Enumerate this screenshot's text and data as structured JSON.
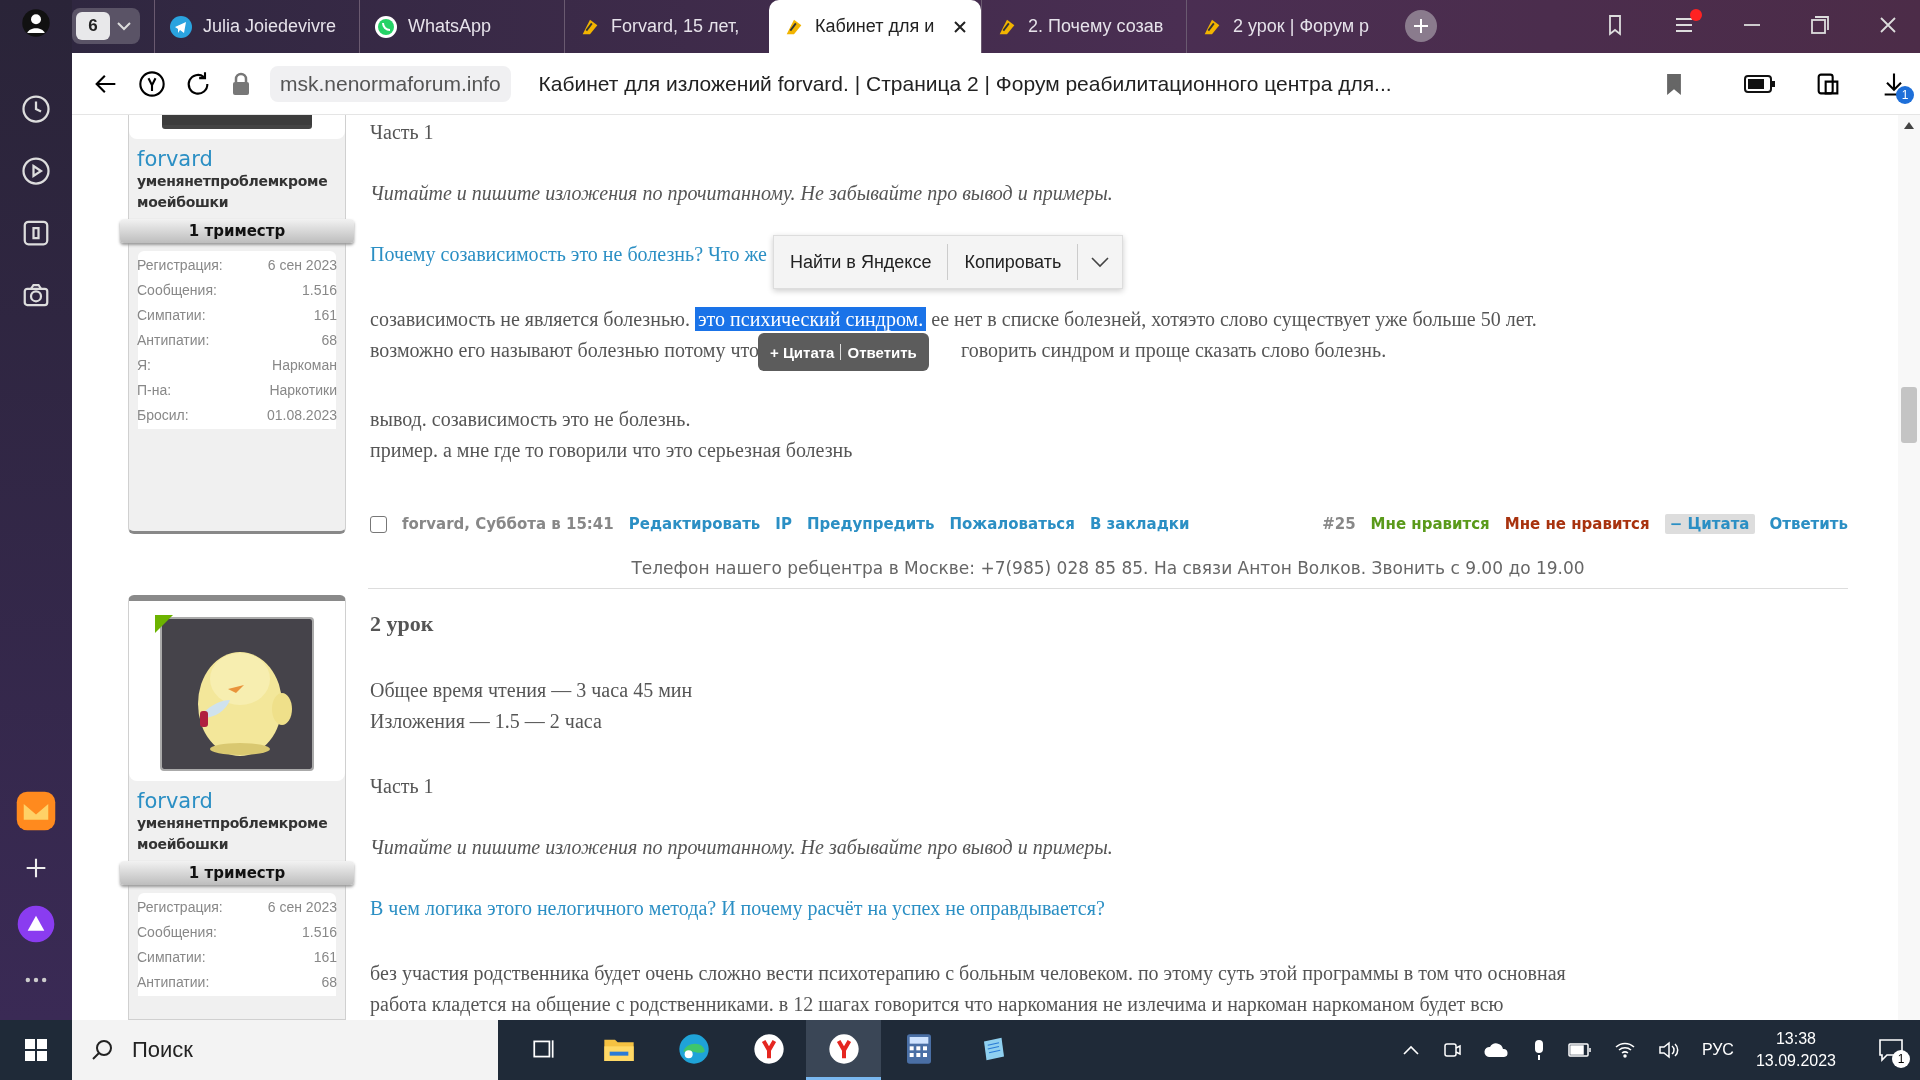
{
  "browser": {
    "tab_count": "6",
    "tabs": [
      {
        "title": "Julia Joiedevivre",
        "selected": false
      },
      {
        "title": "WhatsApp",
        "selected": false
      },
      {
        "title": "Forvard, 15 лет, ",
        "selected": false
      },
      {
        "title": "Кабинет для и",
        "selected": true
      },
      {
        "title": "2. Почему созав",
        "selected": false
      },
      {
        "title": "2 урок | Форум р",
        "selected": false
      }
    ],
    "url": "msk.nenormaforum.info",
    "page_title": "Кабинет для изложений forvard. | Страница 2 | Форум реабилитационного центра для...",
    "downloads_badge": "1"
  },
  "posts": [
    {
      "user": {
        "name": "forvard",
        "user_title": "уменянетпроблемкроме моейбошки",
        "rank": "1 триместр",
        "stats": [
          {
            "label": "Регистрация:",
            "value": "6 сен 2023"
          },
          {
            "label": "Сообщения:",
            "value": "1.516"
          },
          {
            "label": "Симпатии:",
            "value": "161"
          },
          {
            "label": "Антипатии:",
            "value": "68"
          },
          {
            "label": "Я:",
            "value": "Наркоман"
          },
          {
            "label": "П-на:",
            "value": "Наркотики"
          },
          {
            "label": "Бросил:",
            "value": "01.08.2023"
          }
        ]
      },
      "blocks": [
        {
          "kind": "plain",
          "text": "Часть 1"
        },
        {
          "kind": "italic",
          "text": "Читайте и пишите изложения по прочитанному. Не забывайте про вывод и примеры."
        },
        {
          "kind": "question",
          "text": "Почему созависимость это не болезнь? Что же"
        },
        {
          "kind": "selection",
          "before": "созависимость не является болезнью.",
          "selected_text": "это психический синдром.",
          "after": "ее нет в списке болезней, хотяэто слово существует уже больше 50 лет.",
          "line2_before": "возможно его называют болезнью потому что",
          "line2_after": "говорить синдром и проще сказать слово болезнь."
        },
        {
          "kind": "lines",
          "lines": [
            "вывод. созависимость это не болезнь.",
            "пример. а мне где то говорили что это серьезная болезнь"
          ]
        }
      ],
      "footer": {
        "checked": false,
        "author_date": "forvard, Суббота в 15:41",
        "links": [
          "Редактировать",
          "IP",
          "Предупредить",
          "Пожаловаться",
          "В закладки"
        ],
        "number": "#25",
        "like": "Мне нравится",
        "dislike": "Мне не нравится",
        "quote": "− Цитата",
        "quote_selected": true,
        "reply": "Ответить"
      },
      "notice": "Телефон нашего ребцентра в Москве: +7(985) 028 85 85. На связи Антон Волков. Звонить с 9.00 до 19.00"
    },
    {
      "user": {
        "name": "forvard",
        "user_title": "уменянетпроблемкроме моейбошки",
        "rank": "1 триместр",
        "online": true,
        "stats": [
          {
            "label": "Регистрация:",
            "value": "6 сен 2023"
          },
          {
            "label": "Сообщения:",
            "value": "1.516"
          },
          {
            "label": "Симпатии:",
            "value": "161"
          },
          {
            "label": "Антипатии:",
            "value": "68"
          }
        ]
      },
      "heading": "2 урок",
      "blocks": [
        {
          "kind": "lines",
          "lines": [
            "Общее время чтения — 3 часа 45 мин",
            "Изложения — 1.5 — 2 часа"
          ]
        },
        {
          "kind": "plain",
          "text": "Часть 1"
        },
        {
          "kind": "italic",
          "text": "Читайте и пишите изложения по прочитанному. Не забывайте про вывод и примеры."
        },
        {
          "kind": "question",
          "text": "В чем логика этого нелогичного метода? И почему расчёт на успех не оправдывается?"
        },
        {
          "kind": "lines",
          "lines": [
            "без участия родственника будет очень сложно вести психотерапию с больным человеком. по этому суть этой программы в том что основная",
            "работа кладется на общение с родственниками. в 12 шагах говорится что наркомания не излечима и наркоман наркоманом будет всю"
          ]
        }
      ]
    }
  ],
  "context_menu": {
    "items": [
      "Найти в Яндексе",
      "Копировать"
    ]
  },
  "quote_popup": {
    "quote": "+ Цитата",
    "reply": "Ответить"
  },
  "taskbar": {
    "search_placeholder": "Поиск",
    "apps": [
      {
        "active": false
      },
      {
        "active": false
      },
      {
        "active": false
      },
      {
        "active": false
      },
      {
        "active": true
      },
      {
        "active": false
      },
      {
        "active": false
      }
    ],
    "language": "РУС",
    "time": "13:38",
    "date": "13.09.2023",
    "notifications": "1"
  }
}
